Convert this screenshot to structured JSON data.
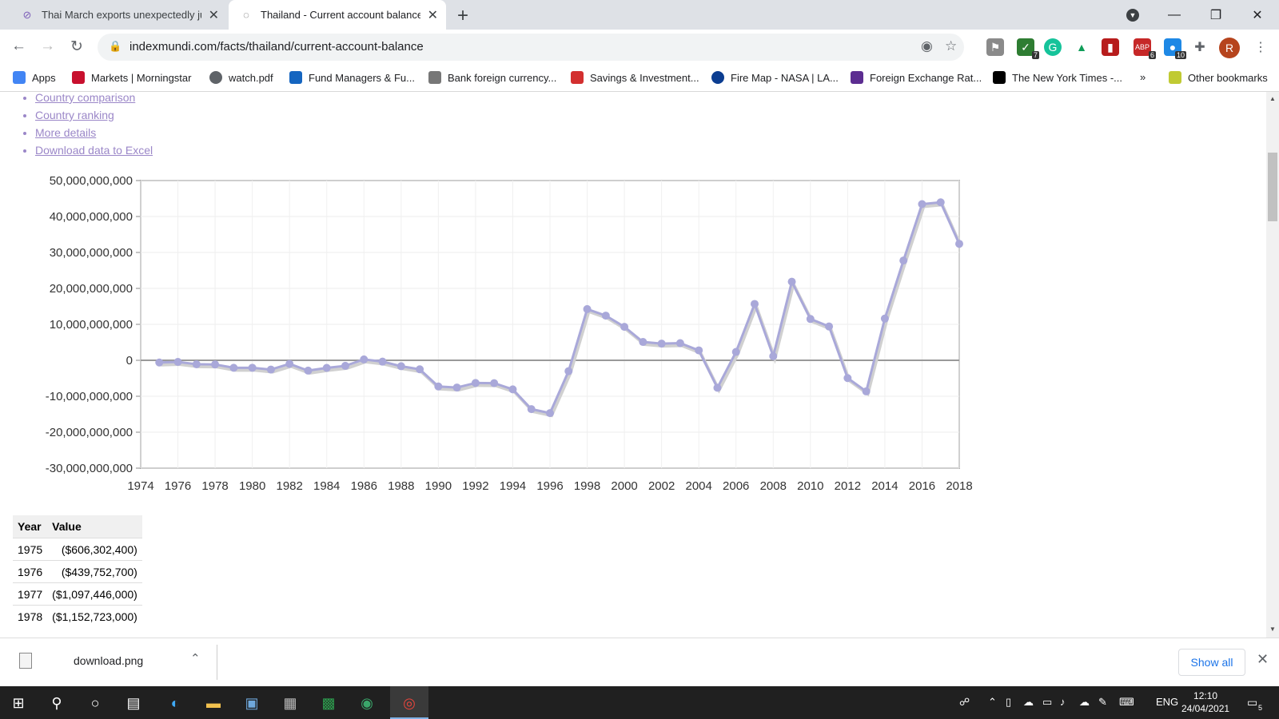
{
  "browser": {
    "tabs": [
      {
        "title": "Thai March exports unexpectedly ju",
        "active": false
      },
      {
        "title": "Thailand - Current account balance",
        "active": true
      }
    ],
    "url": "indexmundi.com/facts/thailand/current-account-balance",
    "profile_initial": "R",
    "extension_badges": {
      "ext2": "7",
      "ext6": "6",
      "ext7": "10"
    }
  },
  "bookmarks": [
    {
      "label": "Apps",
      "icon": "apps-grid-icon",
      "color": "#4285f4"
    },
    {
      "label": "Markets | Morningstar",
      "icon": "morningstar-icon",
      "color": "#c8102e"
    },
    {
      "label": "watch.pdf",
      "icon": "globe-icon",
      "color": "#5f6368"
    },
    {
      "label": "Fund Managers & Fu...",
      "icon": "fund-icon",
      "color": "#1565c0"
    },
    {
      "label": "Bank foreign currency...",
      "icon": "bank-icon",
      "color": "#777777"
    },
    {
      "label": "Savings & Investment...",
      "icon": "savings-icon",
      "color": "#d32f2f"
    },
    {
      "label": "Fire Map - NASA | LA...",
      "icon": "nasa-icon",
      "color": "#0b3d91"
    },
    {
      "label": "Foreign Exchange Rat...",
      "icon": "fx-icon",
      "color": "#5c2d91"
    },
    {
      "label": "The New York Times -...",
      "icon": "nyt-icon",
      "color": "#000000"
    }
  ],
  "bookmarks_overflow": "»",
  "other_bookmarks": "Other bookmarks",
  "links": [
    "Country comparison",
    "Country ranking",
    "More details",
    "Download data to Excel"
  ],
  "chart_data": {
    "type": "line",
    "title": "",
    "xlabel": "",
    "ylabel": "",
    "x_tick_labels": [
      "1974",
      "1976",
      "1978",
      "1980",
      "1982",
      "1984",
      "1986",
      "1988",
      "1990",
      "1992",
      "1994",
      "1996",
      "1998",
      "2000",
      "2002",
      "2004",
      "2006",
      "2008",
      "2010",
      "2012",
      "2014",
      "2016",
      "2018"
    ],
    "y_tick_labels": [
      "50,000,000,000",
      "40,000,000,000",
      "30,000,000,000",
      "20,000,000,000",
      "10,000,000,000",
      "0",
      "-10,000,000,000",
      "-20,000,000,000",
      "-30,000,000,000"
    ],
    "y_ticks": [
      50000000000,
      40000000000,
      30000000000,
      20000000000,
      10000000000,
      0,
      -10000000000,
      -20000000000,
      -30000000000
    ],
    "xlim": [
      1974,
      2018
    ],
    "ylim": [
      -30000000000,
      50000000000
    ],
    "line_color": "#a9a8d9",
    "x": [
      1975,
      1976,
      1977,
      1978,
      1979,
      1980,
      1981,
      1982,
      1983,
      1984,
      1985,
      1986,
      1987,
      1988,
      1989,
      1990,
      1991,
      1992,
      1993,
      1994,
      1995,
      1996,
      1997,
      1998,
      1999,
      2000,
      2001,
      2002,
      2003,
      2004,
      2005,
      2006,
      2007,
      2008,
      2009,
      2010,
      2011,
      2012,
      2013,
      2014,
      2015,
      2016,
      2017,
      2018
    ],
    "y": [
      -606302400,
      -439752700,
      -1097446000,
      -1152723000,
      -2086000000,
      -2070000000,
      -2570000000,
      -1000000000,
      -2870000000,
      -2110000000,
      -1540000000,
      250000000,
      -370000000,
      -1650000000,
      -2500000000,
      -7280000000,
      -7570000000,
      -6300000000,
      -6360000000,
      -8080000000,
      -13580000000,
      -14690000000,
      -3020000000,
      14240000000,
      12430000000,
      9310000000,
      5100000000,
      4650000000,
      4770000000,
      2760000000,
      -7640000000,
      2320000000,
      15680000000,
      1140000000,
      21860000000,
      11490000000,
      9410000000,
      -4950000000,
      -8650000000,
      11600000000,
      27750000000,
      43440000000,
      43950000000,
      32400000000
    ]
  },
  "table": {
    "headers": [
      "Year",
      "Value"
    ],
    "rows": [
      [
        "1975",
        "($606,302,400)"
      ],
      [
        "1976",
        "($439,752,700)"
      ],
      [
        "1977",
        "($1,097,446,000)"
      ],
      [
        "1978",
        "($1,152,723,000)"
      ]
    ]
  },
  "downloads": {
    "file": "download.png",
    "show_all": "Show all"
  },
  "taskbar": {
    "lang": "ENG",
    "time": "12:10",
    "date": "24/04/2021",
    "notifications": "5"
  }
}
